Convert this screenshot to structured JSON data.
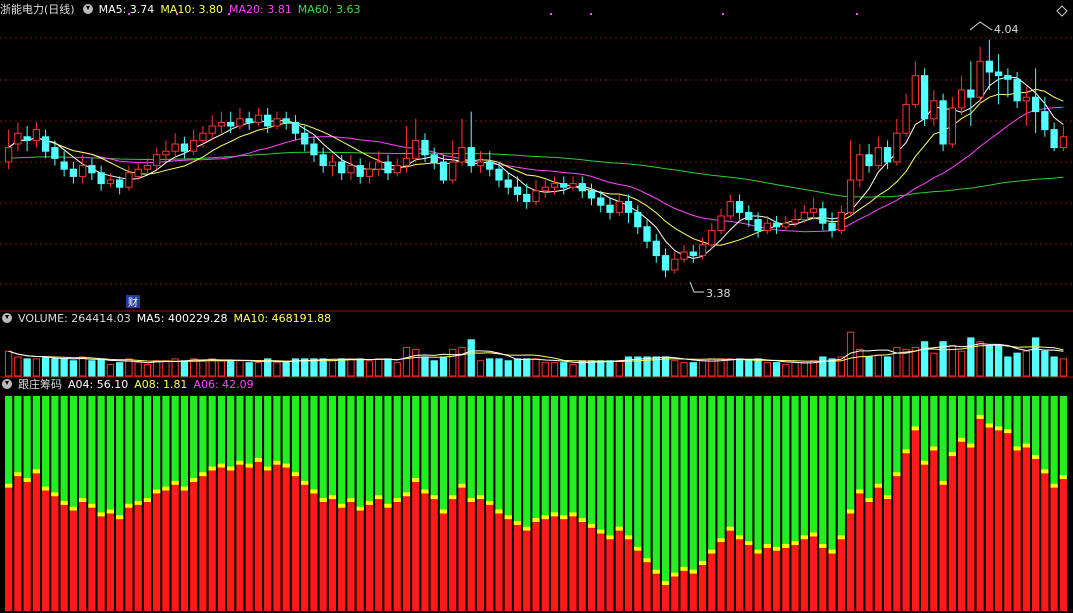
{
  "main_header": {
    "stock_title": "浙能电力(日线)",
    "ma5_label": "MA5: 3.74",
    "ma10_label": "MA10: 3.80",
    "ma20_label": "MA20: 3.81",
    "ma60_label": "MA60: 3.63"
  },
  "annotations": {
    "high_label": "4.04",
    "low_label": "3.38",
    "finance_marker": "财"
  },
  "volume_header": {
    "title": "VOLUME: 264414.03",
    "ma5_label": "MA5: 400229.28",
    "ma10_label": "MA10: 468191.88"
  },
  "chip_header": {
    "title": "跟庄筹码",
    "a04_label": "A04: 56.10",
    "a08_label": "A08: 1.81",
    "a06_label": "A06: 42.09"
  },
  "colors": {
    "background": "#000000",
    "up": "#ff3232",
    "down": "#54ffff",
    "ma5": "#ffffff",
    "ma10": "#ffff66",
    "ma20": "#ff44ff",
    "ma60": "#33cc33",
    "grid": "#7a1010",
    "chip_red": "#ff1a1a",
    "chip_green": "#22ee22",
    "chip_yellow": "#ffff00"
  },
  "chart_data": {
    "type": "candlestick",
    "price_range": [
      3.3,
      4.1
    ],
    "marked_high": 4.04,
    "marked_low": 3.38,
    "candles": [
      [
        3.7,
        3.74,
        3.68,
        3.79
      ],
      [
        3.75,
        3.78,
        3.73,
        3.81
      ],
      [
        3.77,
        3.76,
        3.73,
        3.8
      ],
      [
        3.76,
        3.79,
        3.74,
        3.81
      ],
      [
        3.77,
        3.73,
        3.71,
        3.79
      ],
      [
        3.74,
        3.71,
        3.69,
        3.76
      ],
      [
        3.7,
        3.68,
        3.66,
        3.73
      ],
      [
        3.68,
        3.66,
        3.64,
        3.7
      ],
      [
        3.66,
        3.69,
        3.64,
        3.72
      ],
      [
        3.69,
        3.67,
        3.65,
        3.71
      ],
      [
        3.67,
        3.64,
        3.62,
        3.69
      ],
      [
        3.64,
        3.65,
        3.63,
        3.67
      ],
      [
        3.65,
        3.63,
        3.61,
        3.66
      ],
      [
        3.63,
        3.67,
        3.62,
        3.69
      ],
      [
        3.66,
        3.68,
        3.65,
        3.7
      ],
      [
        3.68,
        3.69,
        3.67,
        3.71
      ],
      [
        3.69,
        3.72,
        3.68,
        3.74
      ],
      [
        3.72,
        3.73,
        3.7,
        3.76
      ],
      [
        3.73,
        3.75,
        3.71,
        3.78
      ],
      [
        3.75,
        3.73,
        3.71,
        3.77
      ],
      [
        3.73,
        3.76,
        3.72,
        3.79
      ],
      [
        3.76,
        3.78,
        3.74,
        3.8
      ],
      [
        3.78,
        3.8,
        3.76,
        3.83
      ],
      [
        3.8,
        3.81,
        3.78,
        3.84
      ],
      [
        3.81,
        3.8,
        3.78,
        3.84
      ],
      [
        3.8,
        3.82,
        3.79,
        3.85
      ],
      [
        3.82,
        3.81,
        3.79,
        3.84
      ],
      [
        3.81,
        3.83,
        3.8,
        3.85
      ],
      [
        3.83,
        3.8,
        3.78,
        3.85
      ],
      [
        3.8,
        3.82,
        3.79,
        3.84
      ],
      [
        3.82,
        3.81,
        3.79,
        3.84
      ],
      [
        3.81,
        3.78,
        3.76,
        3.83
      ],
      [
        3.78,
        3.75,
        3.73,
        3.8
      ],
      [
        3.75,
        3.72,
        3.7,
        3.77
      ],
      [
        3.72,
        3.69,
        3.67,
        3.74
      ],
      [
        3.69,
        3.7,
        3.66,
        3.72
      ],
      [
        3.7,
        3.67,
        3.65,
        3.72
      ],
      [
        3.67,
        3.69,
        3.65,
        3.72
      ],
      [
        3.69,
        3.66,
        3.64,
        3.71
      ],
      [
        3.66,
        3.68,
        3.64,
        3.7
      ],
      [
        3.68,
        3.7,
        3.66,
        3.73
      ],
      [
        3.7,
        3.67,
        3.65,
        3.72
      ],
      [
        3.67,
        3.69,
        3.66,
        3.71
      ],
      [
        3.69,
        3.71,
        3.67,
        3.8
      ],
      [
        3.71,
        3.76,
        3.7,
        3.82
      ],
      [
        3.76,
        3.72,
        3.7,
        3.78
      ],
      [
        3.72,
        3.7,
        3.68,
        3.74
      ],
      [
        3.7,
        3.65,
        3.64,
        3.72
      ],
      [
        3.65,
        3.7,
        3.64,
        3.76
      ],
      [
        3.7,
        3.74,
        3.69,
        3.82
      ],
      [
        3.74,
        3.69,
        3.67,
        3.84
      ],
      [
        3.69,
        3.7,
        3.67,
        3.73
      ],
      [
        3.7,
        3.68,
        3.66,
        3.73
      ],
      [
        3.68,
        3.65,
        3.63,
        3.7
      ],
      [
        3.65,
        3.63,
        3.61,
        3.67
      ],
      [
        3.63,
        3.61,
        3.59,
        3.66
      ],
      [
        3.61,
        3.59,
        3.57,
        3.64
      ],
      [
        3.59,
        3.62,
        3.58,
        3.65
      ],
      [
        3.62,
        3.63,
        3.6,
        3.65
      ],
      [
        3.63,
        3.64,
        3.61,
        3.66
      ],
      [
        3.64,
        3.63,
        3.61,
        3.66
      ],
      [
        3.63,
        3.64,
        3.62,
        3.66
      ],
      [
        3.64,
        3.62,
        3.6,
        3.66
      ],
      [
        3.62,
        3.6,
        3.58,
        3.64
      ],
      [
        3.6,
        3.58,
        3.56,
        3.62
      ],
      [
        3.58,
        3.56,
        3.54,
        3.6
      ],
      [
        3.56,
        3.59,
        3.55,
        3.61
      ],
      [
        3.59,
        3.56,
        3.53,
        3.61
      ],
      [
        3.56,
        3.52,
        3.5,
        3.58
      ],
      [
        3.52,
        3.48,
        3.46,
        3.54
      ],
      [
        3.48,
        3.44,
        3.42,
        3.5
      ],
      [
        3.44,
        3.4,
        3.38,
        3.46
      ],
      [
        3.4,
        3.43,
        3.39,
        3.45
      ],
      [
        3.43,
        3.45,
        3.42,
        3.47
      ],
      [
        3.45,
        3.44,
        3.42,
        3.47
      ],
      [
        3.44,
        3.47,
        3.43,
        3.49
      ],
      [
        3.47,
        3.51,
        3.46,
        3.53
      ],
      [
        3.51,
        3.55,
        3.5,
        3.57
      ],
      [
        3.55,
        3.59,
        3.54,
        3.61
      ],
      [
        3.59,
        3.56,
        3.54,
        3.61
      ],
      [
        3.56,
        3.54,
        3.52,
        3.58
      ],
      [
        3.54,
        3.51,
        3.49,
        3.56
      ],
      [
        3.51,
        3.53,
        3.5,
        3.55
      ],
      [
        3.53,
        3.52,
        3.5,
        3.55
      ],
      [
        3.52,
        3.53,
        3.51,
        3.55
      ],
      [
        3.53,
        3.54,
        3.52,
        3.57
      ],
      [
        3.54,
        3.56,
        3.53,
        3.58
      ],
      [
        3.56,
        3.57,
        3.54,
        3.6
      ],
      [
        3.57,
        3.53,
        3.51,
        3.59
      ],
      [
        3.53,
        3.51,
        3.49,
        3.56
      ],
      [
        3.51,
        3.56,
        3.5,
        3.58
      ],
      [
        3.56,
        3.65,
        3.55,
        3.76
      ],
      [
        3.65,
        3.72,
        3.63,
        3.75
      ],
      [
        3.72,
        3.69,
        3.67,
        3.75
      ],
      [
        3.69,
        3.74,
        3.68,
        3.77
      ],
      [
        3.74,
        3.7,
        3.68,
        3.76
      ],
      [
        3.7,
        3.78,
        3.69,
        3.82
      ],
      [
        3.78,
        3.86,
        3.77,
        3.89
      ],
      [
        3.86,
        3.94,
        3.85,
        3.98
      ],
      [
        3.94,
        3.82,
        3.8,
        3.96
      ],
      [
        3.82,
        3.87,
        3.8,
        3.9
      ],
      [
        3.87,
        3.75,
        3.73,
        3.89
      ],
      [
        3.75,
        3.85,
        3.74,
        3.88
      ],
      [
        3.85,
        3.9,
        3.83,
        3.94
      ],
      [
        3.9,
        3.88,
        3.8,
        3.98
      ],
      [
        3.88,
        3.98,
        3.86,
        4.02
      ],
      [
        3.98,
        3.95,
        3.9,
        4.04
      ],
      [
        3.95,
        3.94,
        3.86,
        4.0
      ],
      [
        3.94,
        3.93,
        3.88,
        3.96
      ],
      [
        3.93,
        3.87,
        3.85,
        3.95
      ],
      [
        3.87,
        3.88,
        3.8,
        3.91
      ],
      [
        3.88,
        3.84,
        3.78,
        3.96
      ],
      [
        3.84,
        3.79,
        3.77,
        3.88
      ],
      [
        3.79,
        3.74,
        3.73,
        3.81
      ],
      [
        3.74,
        3.77,
        3.73,
        3.8
      ]
    ],
    "volume": {
      "ma5": 400229.28,
      "ma10": 468191.88,
      "latest": 264414.03
    },
    "chip": {
      "range": [
        0,
        100
      ],
      "latest": {
        "A04": 56.1,
        "A08": 1.81,
        "A06": 42.09
      }
    }
  }
}
